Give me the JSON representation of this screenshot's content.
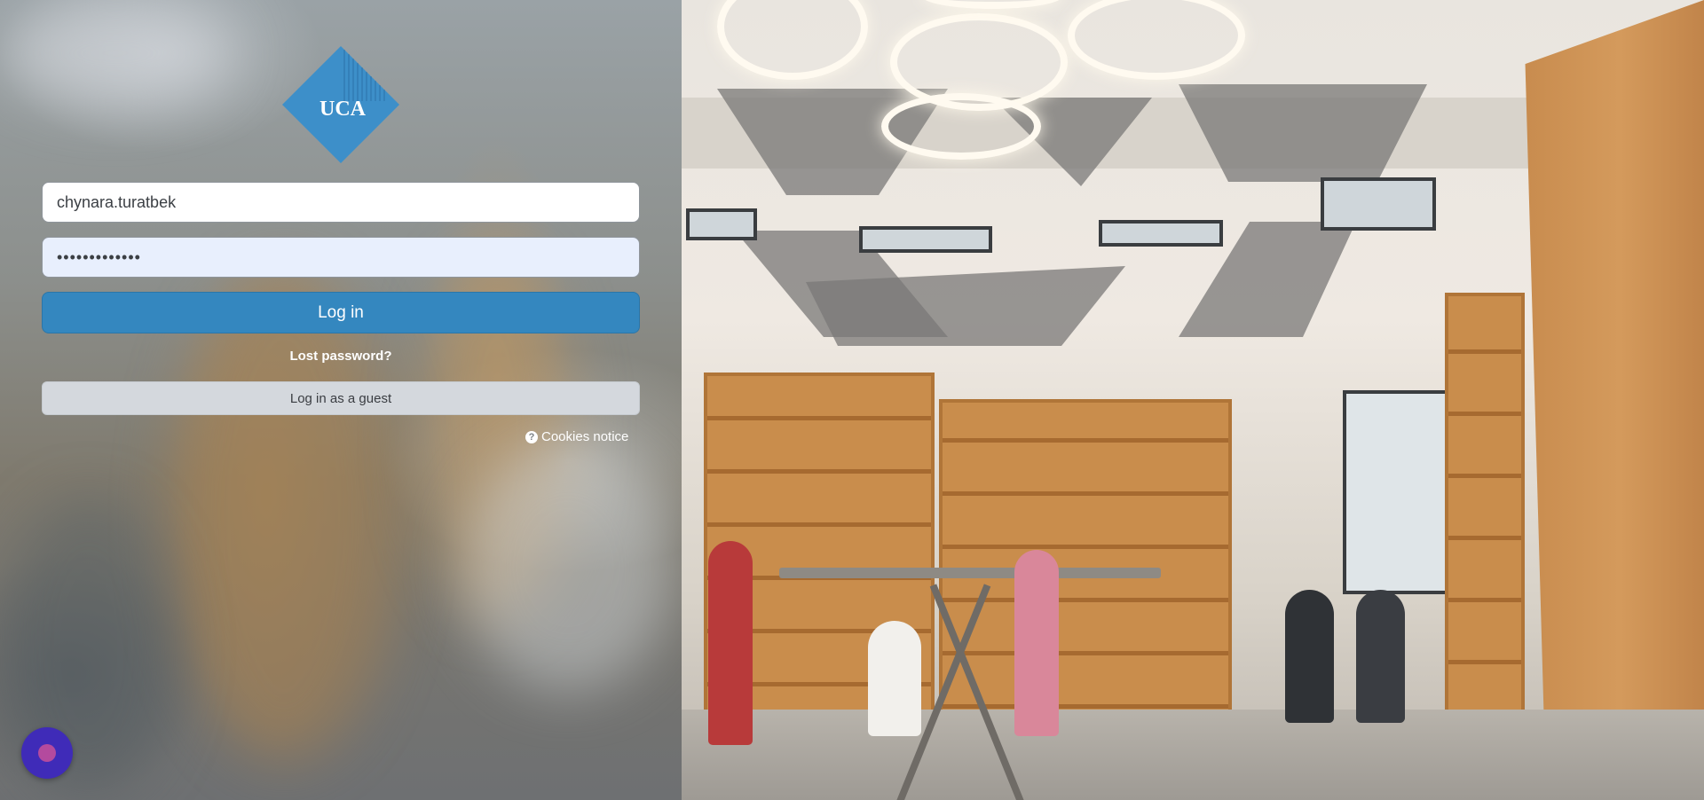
{
  "login": {
    "logo_text": "UCA",
    "username_value": "chynara.turatbek",
    "password_mask": "•••••••••••••",
    "login_button": "Log in",
    "lost_password": "Lost password?",
    "guest_button": "Log in as a guest",
    "cookies_notice": "Cookies notice"
  },
  "colors": {
    "logo_blue": "#3d8fc9",
    "login_button": "#3487bf",
    "guest_button": "#d4d8dd",
    "chat_bubble": "#3f2bb8"
  },
  "icons": {
    "cookies": "question-circle-icon",
    "chat": "chat-bubble-icon"
  }
}
